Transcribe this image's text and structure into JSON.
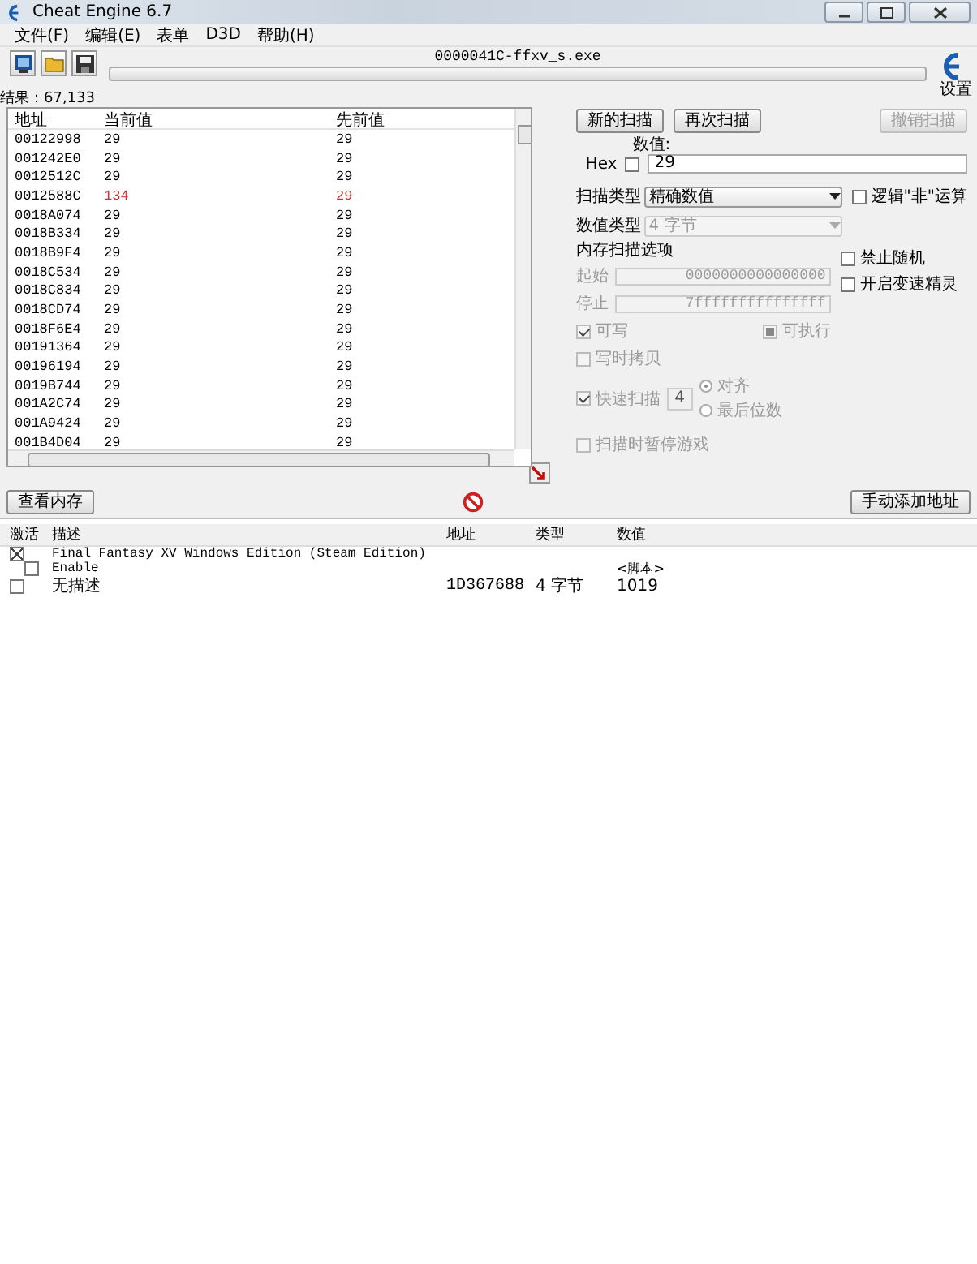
{
  "window": {
    "title": "Cheat Engine 6.7"
  },
  "menu": [
    "文件(F)",
    "编辑(E)",
    "表单",
    "D3D",
    "帮助(H)"
  ],
  "process": "0000041C-ffxv_s.exe",
  "progress": {
    "level": 0
  },
  "settings_label": "设置",
  "results_count": "结果：67,133",
  "results": {
    "columns": [
      "地址",
      "当前值",
      "先前值"
    ],
    "rows": [
      {
        "address": "00122998",
        "value": "29",
        "previous": "29",
        "changed": false
      },
      {
        "address": "001242E0",
        "value": "29",
        "previous": "29",
        "changed": false
      },
      {
        "address": "0012512C",
        "value": "29",
        "previous": "29",
        "changed": false
      },
      {
        "address": "0012588C",
        "value": "134",
        "previous": "29",
        "changed": true
      },
      {
        "address": "0018A074",
        "value": "29",
        "previous": "29",
        "changed": false
      },
      {
        "address": "0018B334",
        "value": "29",
        "previous": "29",
        "changed": false
      },
      {
        "address": "0018B9F4",
        "value": "29",
        "previous": "29",
        "changed": false
      },
      {
        "address": "0018C534",
        "value": "29",
        "previous": "29",
        "changed": false
      },
      {
        "address": "0018C834",
        "value": "29",
        "previous": "29",
        "changed": false
      },
      {
        "address": "0018CD74",
        "value": "29",
        "previous": "29",
        "changed": false
      },
      {
        "address": "0018F6E4",
        "value": "29",
        "previous": "29",
        "changed": false
      },
      {
        "address": "00191364",
        "value": "29",
        "previous": "29",
        "changed": false
      },
      {
        "address": "00196194",
        "value": "29",
        "previous": "29",
        "changed": false
      },
      {
        "address": "0019B744",
        "value": "29",
        "previous": "29",
        "changed": false
      },
      {
        "address": "001A2C74",
        "value": "29",
        "previous": "29",
        "changed": false
      },
      {
        "address": "001A9424",
        "value": "29",
        "previous": "29",
        "changed": false
      },
      {
        "address": "001B4D04",
        "value": "29",
        "previous": "29",
        "changed": false
      }
    ]
  },
  "scan": {
    "buttons": [
      {
        "label": "新的扫描",
        "disabled": false
      },
      {
        "label": "再次扫描",
        "disabled": false
      },
      {
        "label": "撤销扫描",
        "disabled": true
      }
    ],
    "value_label": "数值:",
    "hex": {
      "label": "Hex",
      "checked": false
    },
    "value": "29",
    "scan_type": {
      "label": "扫描类型",
      "value": "精确数值",
      "disabled": false
    },
    "not_option": {
      "label": "逻辑\"非\"运算",
      "checked": false
    },
    "value_type": {
      "label": "数值类型",
      "value": "4 字节",
      "disabled": true
    },
    "memory_options": {
      "title": "内存扫描选项",
      "disabled": true,
      "start_label": "起始",
      "start": "0000000000000000",
      "stop_label": "停止",
      "stop": "7fffffffffffffff",
      "writable": {
        "label": "可写",
        "checked": true
      },
      "executable": {
        "label": "可执行",
        "checked": true
      },
      "copy_on_write": {
        "label": "写时拷贝",
        "checked": false
      },
      "fast_scan": {
        "label": "快速扫描",
        "checked": true,
        "value": "4"
      },
      "align": [
        {
          "label": "对齐",
          "selected": true
        },
        {
          "label": "最后位数",
          "selected": false
        }
      ],
      "pause": {
        "label": "扫描时暂停游戏",
        "checked": false
      }
    },
    "side_options": [
      {
        "label": "禁止随机",
        "checked": false
      },
      {
        "label": "开启变速精灵",
        "checked": false
      }
    ]
  },
  "view_memory_button": "查看内存",
  "add_address_button": "手动添加地址",
  "cheat_table": {
    "columns": [
      "激活",
      "描述",
      "地址",
      "类型",
      "数值"
    ],
    "entries": [
      {
        "active": true,
        "description": "Final Fantasy XV Windows Edition (Steam Edition)",
        "children": [
          {
            "active": false,
            "description": "Enable",
            "value": "<脚本>"
          }
        ]
      },
      {
        "active": false,
        "description": "无描述",
        "address": "1D367688",
        "type": "4 字节",
        "value": "1019"
      }
    ]
  }
}
